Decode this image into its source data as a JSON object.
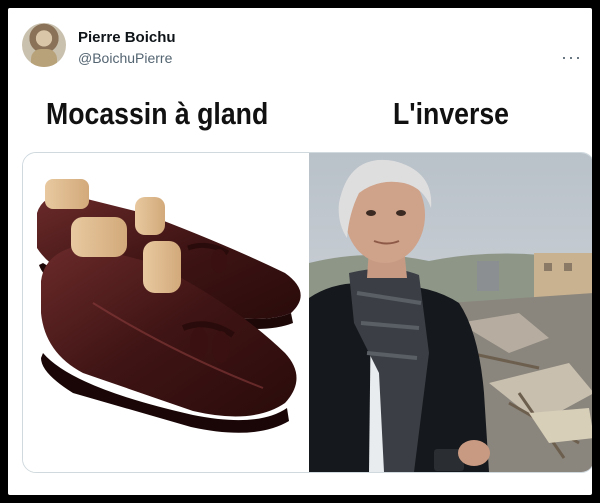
{
  "tweet": {
    "author": {
      "display_name": "Pierre Boichu",
      "handle": "@BoichuPierre"
    },
    "more_icon": "more-horizontal-icon",
    "headings": {
      "left": "Mocassin à gland",
      "right": "L'inverse"
    },
    "media": {
      "left_image": "tassel loafer shoes",
      "right_image": "man in coat in front of rubble"
    }
  },
  "colors": {
    "background": "#000000",
    "card": "#ffffff",
    "secondary_text": "#536471",
    "shoe_leather": "#4a1c1c"
  }
}
